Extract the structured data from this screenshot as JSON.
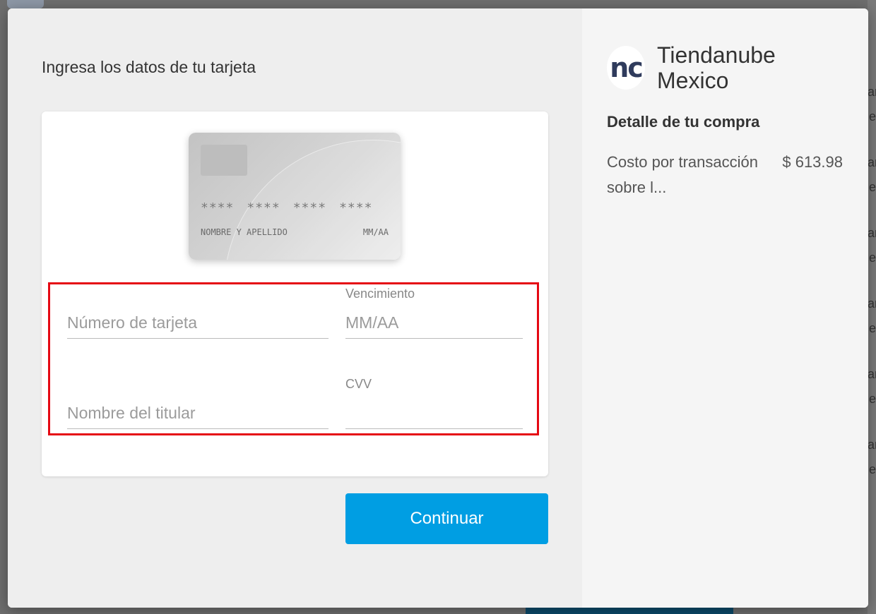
{
  "form": {
    "title": "Ingresa los datos de tu tarjeta",
    "card_preview": {
      "number_groups": [
        "****",
        "****",
        "****",
        "****"
      ],
      "holder_placeholder": "NOMBRE Y APELLIDO",
      "expiry_placeholder": "MM/AA"
    },
    "fields": {
      "card_number": {
        "placeholder": "Número de tarjeta",
        "value": ""
      },
      "expiry": {
        "label": "Vencimiento",
        "placeholder": "MM/AA",
        "value": ""
      },
      "holder_name": {
        "placeholder": "Nombre del titular",
        "value": ""
      },
      "cvv": {
        "label": "CVV",
        "placeholder": "",
        "value": ""
      }
    },
    "continue_label": "Continuar"
  },
  "merchant": {
    "logo_text": "nc",
    "name_line1": "Tiendanube",
    "name_line2": "Mexico"
  },
  "summary": {
    "title": "Detalle de tu compra",
    "items": [
      {
        "label": "Costo por transacción sobre l...",
        "amount": "$ 613.98"
      }
    ]
  },
  "colors": {
    "accent": "#009ee3",
    "highlight": "#e50914",
    "logo": "#2f3b5c"
  },
  "background_hints": {
    "right_edge_letters": [
      "ar",
      "e",
      "ar",
      "e",
      "ar",
      "e",
      "ar",
      "e",
      "ar",
      "e",
      "ar",
      "e"
    ]
  }
}
